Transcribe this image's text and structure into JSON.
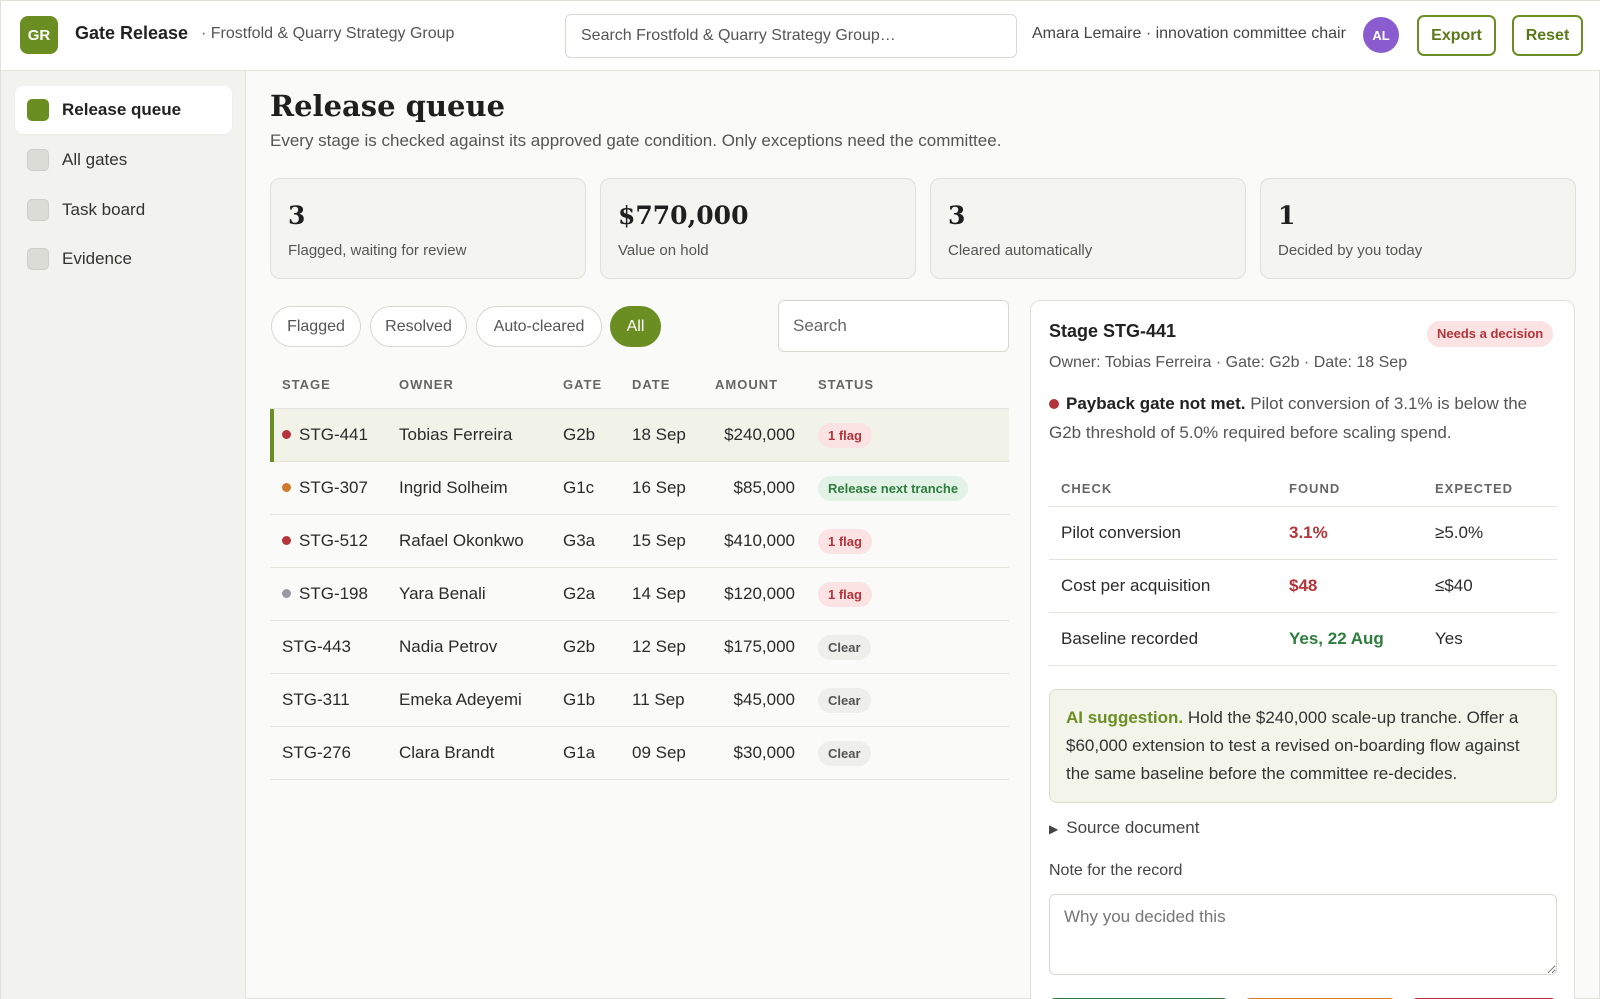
{
  "header": {
    "logo": "GR",
    "app_title": "Gate Release",
    "org": "· Frostfold & Quarry Strategy Group",
    "search_placeholder": "Search Frostfold & Quarry Strategy Group…",
    "user_label": "Amara Lemaire · innovation committee chair",
    "avatar": "AL",
    "export_label": "Export",
    "reset_label": "Reset"
  },
  "sidebar": {
    "items": [
      {
        "label": "Release queue",
        "active": true
      },
      {
        "label": "All gates"
      },
      {
        "label": "Task board"
      },
      {
        "label": "Evidence"
      }
    ]
  },
  "main": {
    "title": "Release queue",
    "subtitle": "Every stage is checked against its approved gate condition. Only exceptions need the committee.",
    "stats": [
      {
        "value": "3",
        "label": "Flagged, waiting for review"
      },
      {
        "value": "$770,000",
        "label": "Value on hold"
      },
      {
        "value": "3",
        "label": "Cleared automatically"
      },
      {
        "value": "1",
        "label": "Decided by you today"
      }
    ],
    "filters": [
      "Flagged",
      "Resolved",
      "Auto-cleared",
      "All"
    ],
    "active_filter": "All",
    "search_placeholder": "Search"
  },
  "table": {
    "headers": [
      "STAGE",
      "OWNER",
      "GATE",
      "DATE",
      "AMOUNT",
      "STATUS"
    ],
    "rows": [
      {
        "stage": "STG-441",
        "owner": "Tobias Ferreira",
        "gate": "G2b",
        "date": "18 Sep",
        "amount": "$240,000",
        "status": "1 flag",
        "dot": "red",
        "selected": true
      },
      {
        "stage": "STG-307",
        "owner": "Ingrid Solheim",
        "gate": "G1c",
        "date": "16 Sep",
        "amount": "$85,000",
        "status": "Release next tranche",
        "dot": "orange"
      },
      {
        "stage": "STG-512",
        "owner": "Rafael Okonkwo",
        "gate": "G3a",
        "date": "15 Sep",
        "amount": "$410,000",
        "status": "1 flag",
        "dot": "red"
      },
      {
        "stage": "STG-198",
        "owner": "Yara Benali",
        "gate": "G2a",
        "date": "14 Sep",
        "amount": "$120,000",
        "status": "1 flag",
        "dot": "gray"
      },
      {
        "stage": "STG-443",
        "owner": "Nadia Petrov",
        "gate": "G2b",
        "date": "12 Sep",
        "amount": "$175,000",
        "status": "Clear"
      },
      {
        "stage": "STG-311",
        "owner": "Emeka Adeyemi",
        "gate": "G1b",
        "date": "11 Sep",
        "amount": "$45,000",
        "status": "Clear"
      },
      {
        "stage": "STG-276",
        "owner": "Clara Brandt",
        "gate": "G1a",
        "date": "09 Sep",
        "amount": "$30,000",
        "status": "Clear"
      }
    ]
  },
  "detail": {
    "title": "Stage STG-441",
    "badge": "Needs a decision",
    "meta": "Owner: Tobias Ferreira · Gate: G2b · Date: 18 Sep",
    "finding_bold": "Payback gate not met.",
    "finding_text": " Pilot conversion of 3.1% is below the G2b threshold of 5.0% required before scaling spend.",
    "check_headers": [
      "CHECK",
      "FOUND",
      "EXPECTED"
    ],
    "checks": [
      {
        "check": "Pilot conversion",
        "found": "3.1%",
        "expected": "≥5.0%",
        "state": "bad"
      },
      {
        "check": "Cost per acquisition",
        "found": "$48",
        "expected": "≤$40",
        "state": "bad"
      },
      {
        "check": "Baseline recorded",
        "found": "Yes, 22 Aug",
        "expected": "Yes",
        "state": "good"
      }
    ],
    "ai_label": "AI suggestion.",
    "ai_text": " Hold the $240,000 scale-up tranche. Offer a $60,000 extension to test a revised on-boarding flow against the same baseline before the committee re-decides.",
    "source_label": "Source document",
    "note_label": "Note for the record",
    "note_placeholder": "Why you decided this"
  },
  "colors": {
    "accent": "#6b8e23",
    "danger": "#b3343a",
    "success": "#2e7d3e",
    "warning": "#d07a2c",
    "avatar": "#8a5ccf"
  }
}
